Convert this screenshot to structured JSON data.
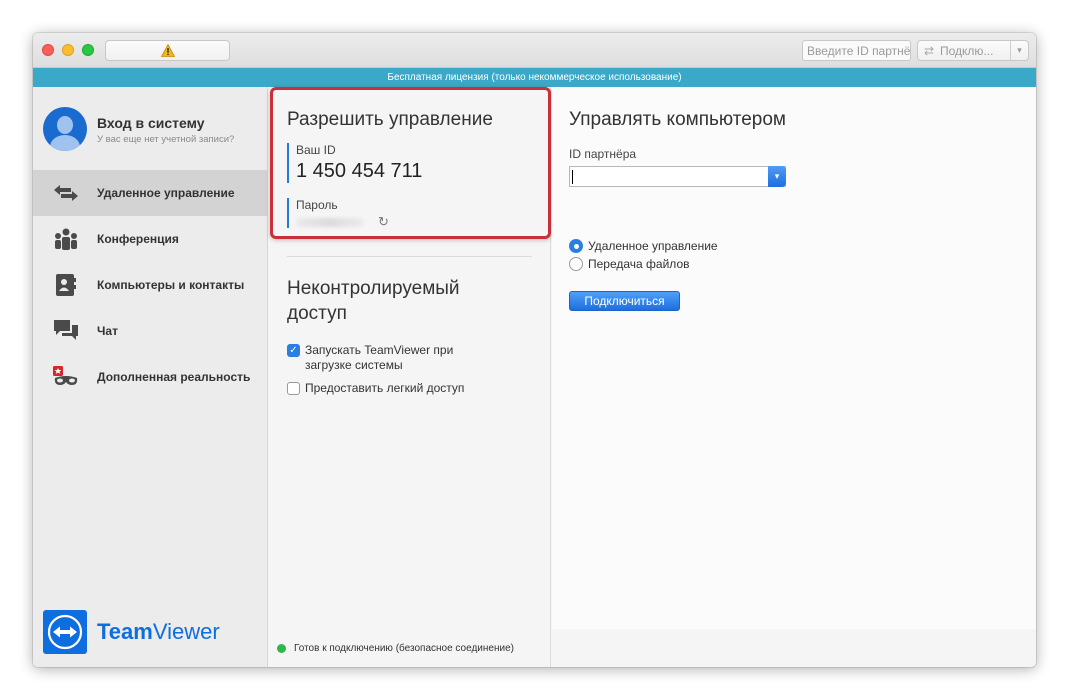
{
  "titlebar": {
    "partner_placeholder": "Введите ID партнёра",
    "connect_label": "Подклю..."
  },
  "license": "Бесплатная лицензия (только некоммерческое использование)",
  "sidebar": {
    "profile_title": "Вход в систему",
    "profile_sub": "У вас еще нет учетной записи?",
    "items": [
      {
        "label": "Удаленное управление",
        "icon": "arrows-icon",
        "active": true
      },
      {
        "label": "Конференция",
        "icon": "people-icon",
        "active": false
      },
      {
        "label": "Компьютеры и контакты",
        "icon": "contacts-icon",
        "active": false
      },
      {
        "label": "Чат",
        "icon": "chat-icon",
        "active": false
      },
      {
        "label": "Дополненная реальность",
        "icon": "ar-icon",
        "active": false
      }
    ],
    "brand_bold": "Team",
    "brand_light": "Viewer"
  },
  "allow": {
    "title": "Разрешить управление",
    "id_label": "Ваш ID",
    "id_value": "1 450 454 711",
    "password_label": "Пароль"
  },
  "unattended": {
    "title": "Неконтролируемый доступ",
    "start_label": "Запускать TeamViewer при загрузке системы",
    "start_checked": true,
    "easy_label": "Предоставить легкий доступ",
    "easy_checked": false
  },
  "control": {
    "title": "Управлять компьютером",
    "partner_label": "ID партнёра",
    "partner_value": "",
    "radio_remote": "Удаленное управление",
    "radio_files": "Передача файлов",
    "selected": "remote",
    "connect_button": "Подключиться"
  },
  "status": {
    "text": "Готов к подключению (безопасное соединение)",
    "color": "#2db84a"
  },
  "colors": {
    "accent": "#1e6fdf",
    "license_bar": "#3aa8c7",
    "highlight": "#c8303a"
  }
}
